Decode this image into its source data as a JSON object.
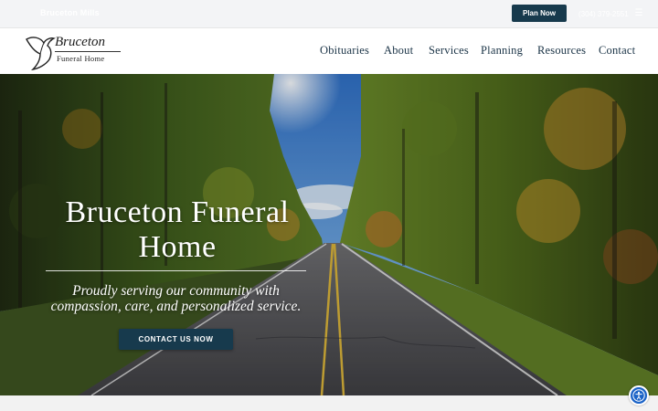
{
  "topbar": {
    "left_text": "Bruceton Mills",
    "plan_button": "Plan Now",
    "phone": "(304) 379-2551",
    "icon": "menu-icon"
  },
  "logo": {
    "line1": "Bruceton",
    "line2": "Funeral Home",
    "icon": "dove-icon"
  },
  "nav": {
    "items": [
      "Obituaries",
      "About",
      "Services",
      "Planning",
      "Resources",
      "Contact"
    ]
  },
  "hero": {
    "title": "Bruceton Funeral Home",
    "subtitle": "Proudly serving our community with compassion, care, and personalized service.",
    "button": "CONTACT US NOW"
  },
  "accessibility": {
    "icon": "accessibility-icon",
    "color": "#1b63c7"
  },
  "colors": {
    "brand_navy": "#173a4d",
    "nav_text": "#1a3346"
  }
}
